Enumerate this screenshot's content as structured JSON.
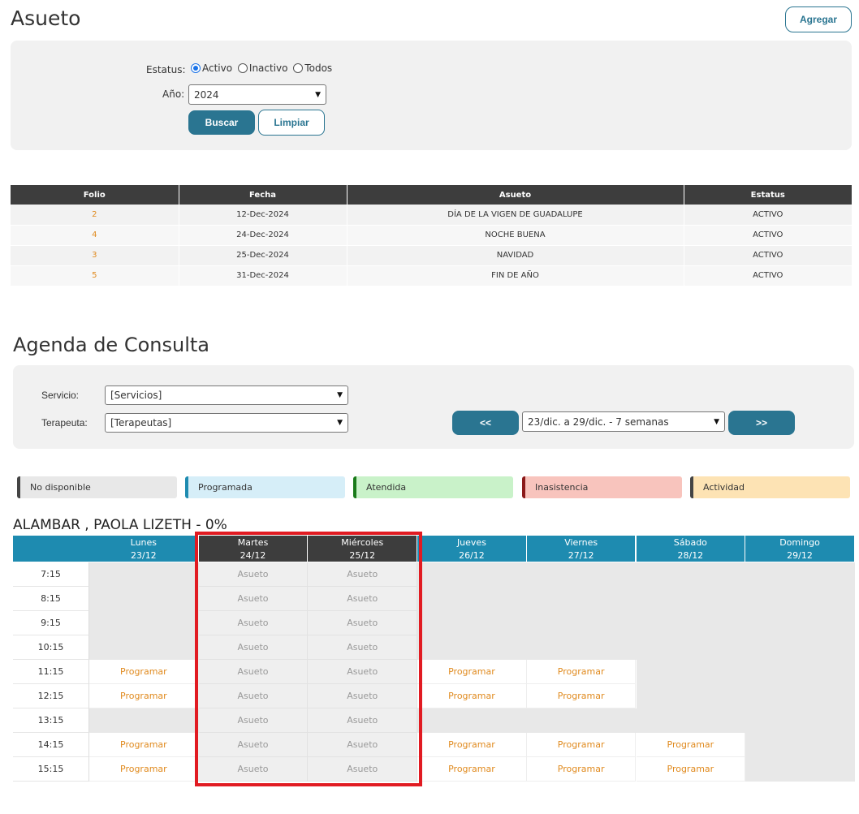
{
  "header": {
    "title": "Asueto",
    "add_label": "Agregar"
  },
  "filters": {
    "status_label": "Estatus:",
    "status_options": [
      {
        "label": "Activo",
        "checked": true
      },
      {
        "label": "Inactivo",
        "checked": false
      },
      {
        "label": "Todos",
        "checked": false
      }
    ],
    "year_label": "Año:",
    "year_value": "2024",
    "search_label": "Buscar",
    "clear_label": "Limpiar"
  },
  "holidays": {
    "columns": [
      "Folio",
      "Fecha",
      "Asueto",
      "Estatus"
    ],
    "rows": [
      [
        "2",
        "12-Dec-2024",
        "DÍA DE LA VIGEN DE GUADALUPE",
        "ACTIVO"
      ],
      [
        "4",
        "24-Dec-2024",
        "NOCHE BUENA",
        "ACTIVO"
      ],
      [
        "3",
        "25-Dec-2024",
        "NAVIDAD",
        "ACTIVO"
      ],
      [
        "5",
        "31-Dec-2024",
        "FIN DE AÑO",
        "ACTIVO"
      ]
    ]
  },
  "agenda": {
    "title": "Agenda de Consulta",
    "service_label": "Servicio:",
    "service_value": "[Servicios]",
    "therapist_label": "Terapeuta:",
    "therapist_value": "[Terapeutas]",
    "prev_label": "<<",
    "next_label": ">>",
    "range_value": "23/dic. a 29/dic. - 7 semanas"
  },
  "legend": [
    {
      "label": "No disponible",
      "bg": "#e8e8e8",
      "accent": "#444444"
    },
    {
      "label": "Programada",
      "bg": "#d6eef8",
      "accent": "#1e8bb0"
    },
    {
      "label": "Atendida",
      "bg": "#c9f2c9",
      "accent": "#1a7a1a"
    },
    {
      "label": "Inasistencia",
      "bg": "#f8c4bd",
      "accent": "#8b1a1a"
    },
    {
      "label": "Actividad",
      "bg": "#fde3b4",
      "accent": "#444444"
    }
  ],
  "schedule": {
    "person": "ALAMBAR , PAOLA LIZETH - 0%",
    "days": [
      {
        "name": "Lunes",
        "date": "23/12"
      },
      {
        "name": "Martes",
        "date": "24/12"
      },
      {
        "name": "Miércoles",
        "date": "25/12"
      },
      {
        "name": "Jueves",
        "date": "26/12"
      },
      {
        "name": "Viernes",
        "date": "27/12"
      },
      {
        "name": "Sábado",
        "date": "28/12"
      },
      {
        "name": "Domingo",
        "date": "29/12"
      }
    ],
    "times": [
      "7:15",
      "8:15",
      "9:15",
      "10:15",
      "11:15",
      "12:15",
      "13:15",
      "14:15",
      "15:15"
    ],
    "program_label": "Programar",
    "holiday_label": "Asueto",
    "cells": [
      [
        "na",
        "asueto",
        "asueto",
        "na",
        "na",
        "na",
        "na"
      ],
      [
        "na",
        "asueto",
        "asueto",
        "na",
        "na",
        "na",
        "na"
      ],
      [
        "na",
        "asueto",
        "asueto",
        "na",
        "na",
        "na",
        "na"
      ],
      [
        "na",
        "asueto",
        "asueto",
        "na",
        "na",
        "na",
        "na"
      ],
      [
        "prog",
        "asueto",
        "asueto",
        "prog",
        "prog",
        "na",
        "na"
      ],
      [
        "prog",
        "asueto",
        "asueto",
        "prog",
        "prog",
        "na",
        "na"
      ],
      [
        "na",
        "asueto",
        "asueto",
        "na",
        "na",
        "na",
        "na"
      ],
      [
        "prog",
        "asueto",
        "asueto",
        "prog",
        "prog",
        "prog",
        "na"
      ],
      [
        "prog",
        "asueto",
        "asueto",
        "prog",
        "prog",
        "prog",
        "na"
      ]
    ]
  },
  "colors": {
    "primary": "#2a7591",
    "header_blue": "#1e8bb0",
    "highlight_red": "#e11b22",
    "link_orange": "#e08a1e"
  }
}
